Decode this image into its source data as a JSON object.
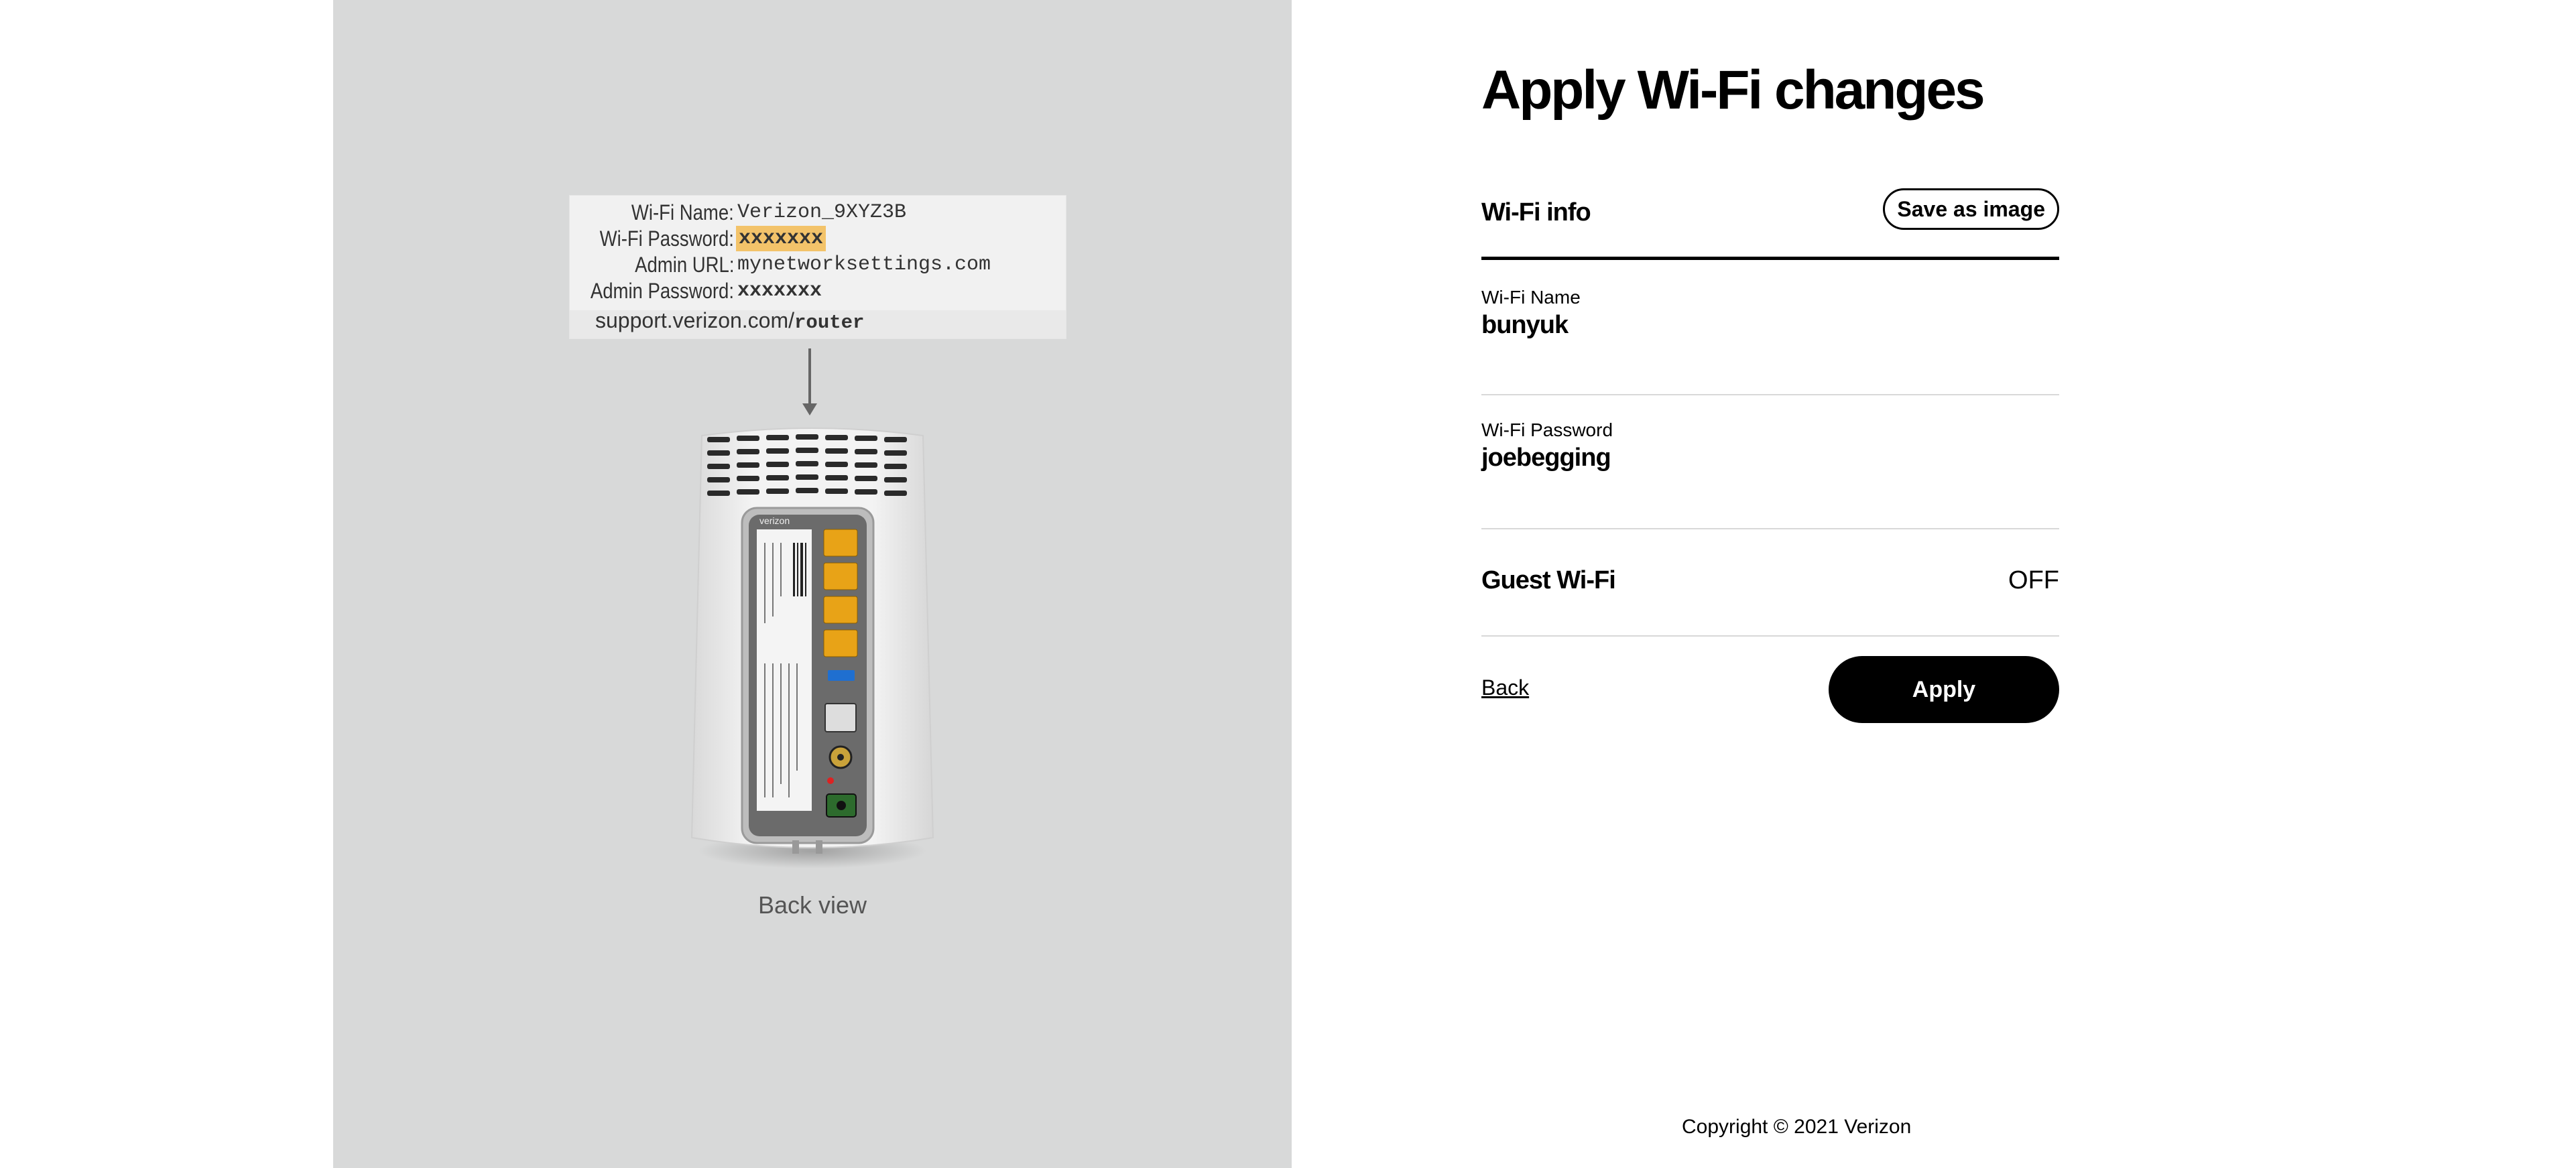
{
  "illustration": {
    "label": {
      "rows": [
        {
          "key": "Wi-Fi Name:",
          "value": "Verizon_9XYZ3B"
        },
        {
          "key": "Wi-Fi Password:",
          "value": "xxxxxxx"
        },
        {
          "key": "Admin URL:",
          "value": "mynetworksettings.com"
        },
        {
          "key": "Admin Password:",
          "value": "xxxxxxx"
        }
      ],
      "support_prefix": "support.verizon.com/",
      "support_suffix": "router"
    },
    "caption": "Back view",
    "device_brand": "verizon"
  },
  "page": {
    "title": "Apply Wi-Fi changes"
  },
  "wifi_info": {
    "section_title": "Wi-Fi info",
    "save_button": "Save as image",
    "name_label": "Wi-Fi Name",
    "name_value": "bunyuk",
    "password_label": "Wi-Fi Password",
    "password_value": "joebegging"
  },
  "guest_wifi": {
    "label": "Guest Wi-Fi",
    "status": "OFF"
  },
  "actions": {
    "back": "Back",
    "apply": "Apply"
  },
  "footer": {
    "copyright": "Copyright © 2021 Verizon"
  },
  "colors": {
    "left_panel_bg": "#d8d9d9",
    "password_highlight": "#f3c36a",
    "port_yellow": "#e8a317",
    "usb_blue": "#1f6fd0",
    "primary_button": "#000000"
  }
}
